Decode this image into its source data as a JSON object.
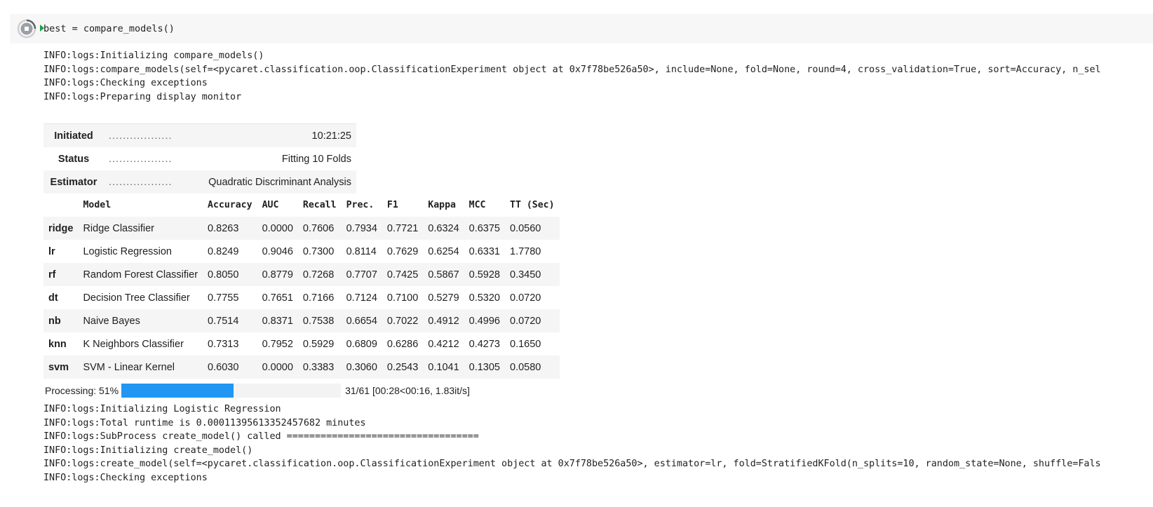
{
  "cell": {
    "code": "best = compare_models()",
    "run_icon": "stop-circle-icon"
  },
  "logs_top": [
    "INFO:logs:Initializing compare_models()",
    "INFO:logs:compare_models(self=<pycaret.classification.oop.ClassificationExperiment object at 0x7f78be526a50>, include=None, fold=None, round=4, cross_validation=True, sort=Accuracy, n_sel",
    "INFO:logs:Checking exceptions",
    "INFO:logs:Preparing display monitor"
  ],
  "monitor": {
    "dots": "..................",
    "rows": [
      {
        "key": "Initiated",
        "value": "10:21:25"
      },
      {
        "key": "Status",
        "value": "Fitting 10 Folds"
      },
      {
        "key": "Estimator",
        "value": "Quadratic Discriminant Analysis"
      }
    ]
  },
  "results": {
    "columns": [
      "",
      "Model",
      "Accuracy",
      "AUC",
      "Recall",
      "Prec.",
      "F1",
      "Kappa",
      "MCC",
      "TT (Sec)"
    ],
    "rows": [
      [
        "ridge",
        "Ridge Classifier",
        "0.8263",
        "0.0000",
        "0.7606",
        "0.7934",
        "0.7721",
        "0.6324",
        "0.6375",
        "0.0560"
      ],
      [
        "lr",
        "Logistic Regression",
        "0.8249",
        "0.9046",
        "0.7300",
        "0.8114",
        "0.7629",
        "0.6254",
        "0.6331",
        "1.7780"
      ],
      [
        "rf",
        "Random Forest Classifier",
        "0.8050",
        "0.8779",
        "0.7268",
        "0.7707",
        "0.7425",
        "0.5867",
        "0.5928",
        "0.3450"
      ],
      [
        "dt",
        "Decision Tree Classifier",
        "0.7755",
        "0.7651",
        "0.7166",
        "0.7124",
        "0.7100",
        "0.5279",
        "0.5320",
        "0.0720"
      ],
      [
        "nb",
        "Naive Bayes",
        "0.7514",
        "0.8371",
        "0.7538",
        "0.6654",
        "0.7022",
        "0.4912",
        "0.4996",
        "0.0720"
      ],
      [
        "knn",
        "K Neighbors Classifier",
        "0.7313",
        "0.7952",
        "0.5929",
        "0.6809",
        "0.6286",
        "0.4212",
        "0.4273",
        "0.1650"
      ],
      [
        "svm",
        "SVM - Linear Kernel",
        "0.6030",
        "0.0000",
        "0.3383",
        "0.3060",
        "0.2543",
        "0.1041",
        "0.1305",
        "0.0580"
      ]
    ]
  },
  "progress": {
    "label": "Processing: 51%",
    "fraction": 0.51,
    "stats": "31/61 [00:28<00:16, 1.83it/s]",
    "color": "#2196f3"
  },
  "logs_bottom": [
    "INFO:logs:Initializing Logistic Regression",
    "INFO:logs:Total runtime is 0.00011395613352457682 minutes",
    "INFO:logs:SubProcess create_model() called ==================================",
    "INFO:logs:Initializing create_model()",
    "INFO:logs:create_model(self=<pycaret.classification.oop.ClassificationExperiment object at 0x7f78be526a50>, estimator=lr, fold=StratifiedKFold(n_splits=10, random_state=None, shuffle=Fals",
    "INFO:logs:Checking exceptions"
  ]
}
